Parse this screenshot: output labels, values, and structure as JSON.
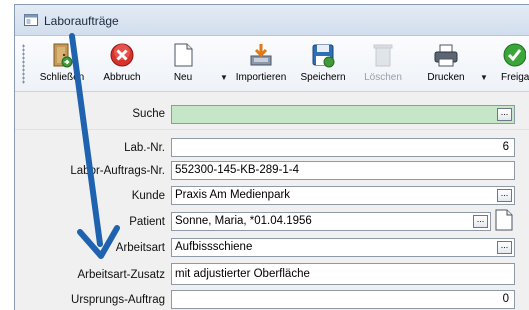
{
  "window": {
    "title": "Laboraufträge"
  },
  "toolbar": {
    "buttons": [
      {
        "label": "Schließen",
        "icon": "door-exit-icon",
        "enabled": true
      },
      {
        "label": "Abbruch",
        "icon": "cancel-x-icon",
        "enabled": true
      },
      {
        "label": "Neu",
        "icon": "new-document-icon",
        "enabled": true
      },
      {
        "label": "Importieren",
        "icon": "import-icon",
        "enabled": true
      },
      {
        "label": "Speichern",
        "icon": "floppy-disk-icon",
        "enabled": true
      },
      {
        "label": "Löschen",
        "icon": "trash-icon",
        "enabled": false
      },
      {
        "label": "Drucken",
        "icon": "printer-icon",
        "enabled": true
      },
      {
        "label": "Freigal",
        "icon": "checkmark-icon",
        "enabled": true
      }
    ]
  },
  "form": {
    "search_label": "Suche",
    "search_value": "",
    "lab_nr_label": "Lab.-Nr.",
    "lab_nr_value": "6",
    "auftrags_nr_label": "Labor-Auftrags-Nr.",
    "auftrags_nr_value": "552300-145-KB-289-1-4",
    "kunde_label": "Kunde",
    "kunde_value": "Praxis Am Medienpark",
    "patient_label": "Patient",
    "patient_value": "Sonne, Maria, *01.04.1956",
    "arbeitsart_label": "Arbeitsart",
    "arbeitsart_value": "Aufbissschiene",
    "zusatz_label": "Arbeitsart-Zusatz",
    "zusatz_value": "mit adjustierter Oberfläche",
    "ursprung_label": "Ursprungs-Auftrag",
    "ursprung_value": "0",
    "ellipsis": "..."
  },
  "colors": {
    "search_field_bg": "#c6e6c8",
    "annotation_arrow": "#1f63b0"
  }
}
